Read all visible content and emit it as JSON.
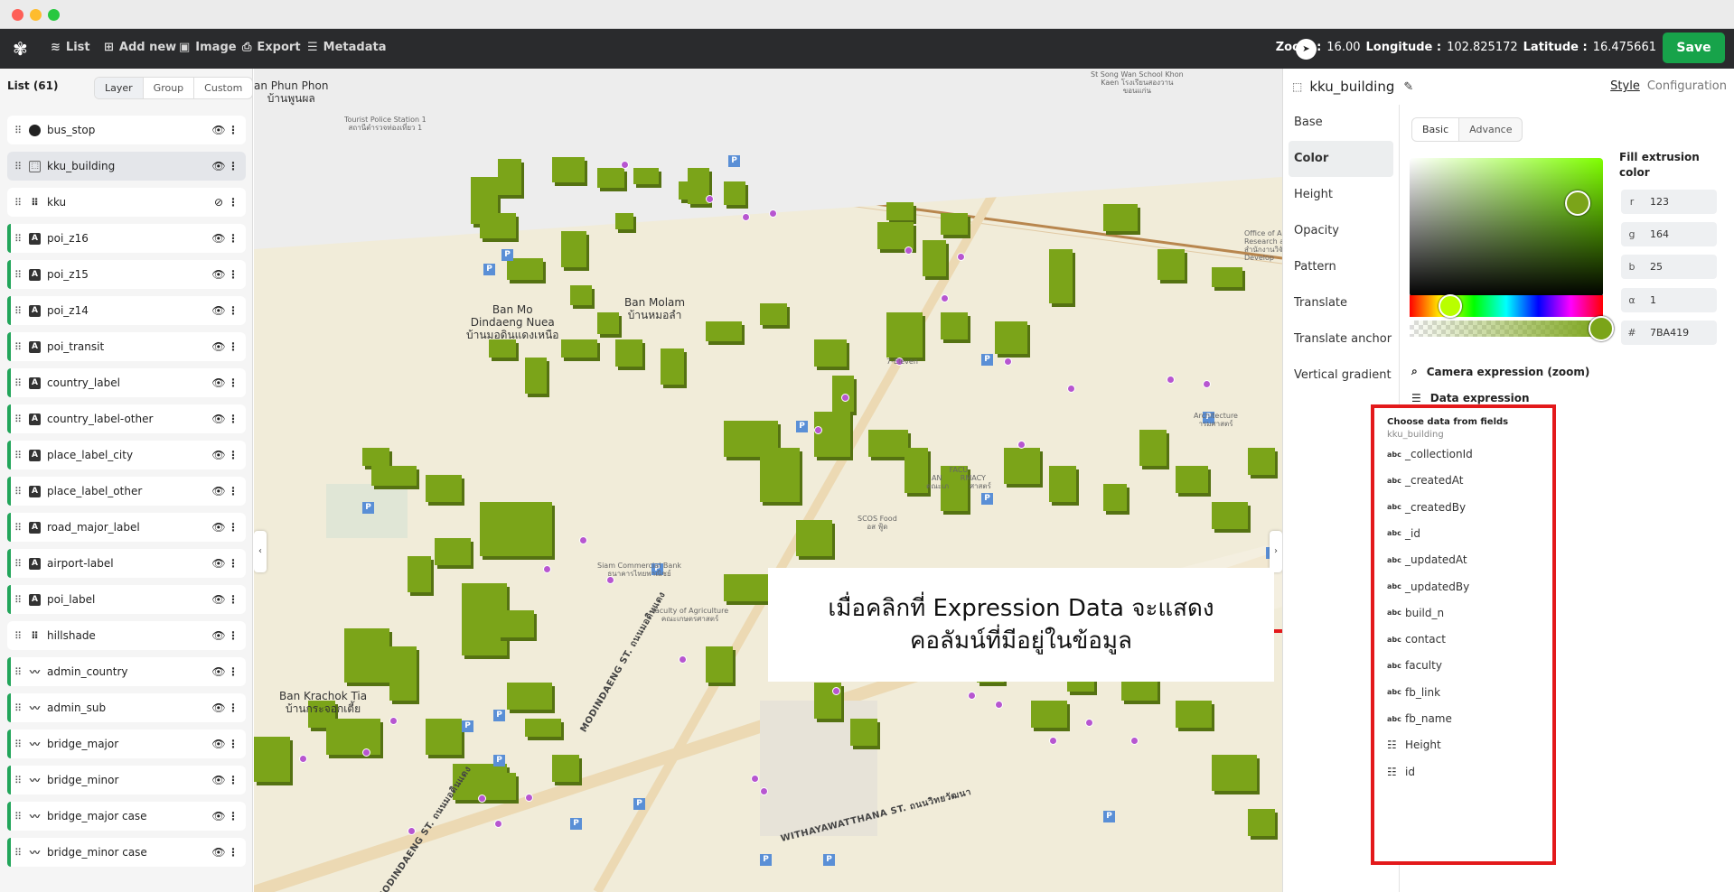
{
  "topbar": {
    "nav": [
      {
        "label": "List",
        "icon": "layers-icon"
      },
      {
        "label": "Add new",
        "icon": "add-icon"
      },
      {
        "label": "Image",
        "icon": "image-icon"
      },
      {
        "label": "Export",
        "icon": "export-icon"
      },
      {
        "label": "Metadata",
        "icon": "metadata-icon"
      }
    ],
    "zoom_label": "Zoom :",
    "zoom_value": "16.00",
    "lon_label": "Longitude :",
    "lon_value": "102.825172",
    "lat_label": "Latitude :",
    "lat_value": "16.475661",
    "save_label": "Save",
    "accent": "#17a34a"
  },
  "left_panel": {
    "title": "List (61)",
    "segments": [
      "Layer",
      "Group",
      "Custom"
    ],
    "active_segment": "Layer",
    "layers": [
      {
        "name": "bus_stop",
        "type": "circle",
        "visible": true
      },
      {
        "name": "kku_building",
        "type": "fill-extrusion",
        "visible": true,
        "selected": true
      },
      {
        "name": "kku",
        "type": "raster",
        "visible": false
      },
      {
        "name": "poi_z16",
        "type": "symbol",
        "visible": true
      },
      {
        "name": "poi_z15",
        "type": "symbol",
        "visible": true
      },
      {
        "name": "poi_z14",
        "type": "symbol",
        "visible": true
      },
      {
        "name": "poi_transit",
        "type": "symbol",
        "visible": true
      },
      {
        "name": "country_label",
        "type": "symbol",
        "visible": true
      },
      {
        "name": "country_label-other",
        "type": "symbol",
        "visible": true
      },
      {
        "name": "place_label_city",
        "type": "symbol",
        "visible": true
      },
      {
        "name": "place_label_other",
        "type": "symbol",
        "visible": true
      },
      {
        "name": "road_major_label",
        "type": "symbol",
        "visible": true
      },
      {
        "name": "airport-label",
        "type": "symbol",
        "visible": true
      },
      {
        "name": "poi_label",
        "type": "symbol",
        "visible": true
      },
      {
        "name": "hillshade",
        "type": "raster",
        "visible": true
      },
      {
        "name": "admin_country",
        "type": "line",
        "visible": true
      },
      {
        "name": "admin_sub",
        "type": "line",
        "visible": true
      },
      {
        "name": "bridge_major",
        "type": "line",
        "visible": true
      },
      {
        "name": "bridge_minor",
        "type": "line",
        "visible": true
      },
      {
        "name": "bridge_major case",
        "type": "line",
        "visible": true
      },
      {
        "name": "bridge_minor case",
        "type": "line",
        "visible": true
      }
    ]
  },
  "map": {
    "labels": {
      "phun_phon": "an Phun Phon\nบ้านพูนผล",
      "ban_mo": "Ban Mo\nDindaeng Nuea\nบ้านมอดินแดงเหนือ",
      "ban_molam": "Ban Molam\nบ้านหมอลำ",
      "krachok": "Ban Krachok Tia\nบ้านกระจอกเตี้ย",
      "seven": "7-Eleven",
      "agri": "Faculty of Agriculture\nคณะเกษตรศาสตร์",
      "architecture": "Architecture\nารมศาสตร์",
      "scos": "SCOS Food\nอส ฟู้ด",
      "siam": "Siam Commercial Bank\nธนาคารไทยพาณิชย์",
      "pharmacy": "FACU\nAN        RMACY\nคณะเภ         ศาสตร์",
      "songwan": "St Song Wan School Khon\nKaen โรงเรียนสองวาน\nขอนแก่น",
      "station": "Tourist Police Station 1\nสถานีตำรวจท่องเที่ยว 1",
      "office": "Office of Agr\nResearch a\nสำนักงานวิจัย\nDevelop",
      "road1": "WITHAYAWATTHANA ST. ถนนวิทยวัฒนา",
      "road2": "MODINDAENG ST. ถนนมอดินแดง"
    },
    "callout": "เมื่อคลิกที่ Expression Data จะแสดง\nคอลัมน์ที่มีอยู่ในข้อมูล",
    "building_color": "#7BA419"
  },
  "right_panel": {
    "layer_name": "kku_building",
    "tabs": [
      "Style",
      "Configuration"
    ],
    "active_tab": "Style",
    "categories": [
      "Base",
      "Color",
      "Height",
      "Opacity",
      "Pattern",
      "Translate",
      "Translate anchor",
      "Vertical gradient"
    ],
    "active_category": "Color",
    "mode_tabs": [
      "Basic",
      "Advance"
    ],
    "active_mode": "Basic",
    "property_label": "Fill extrusion color",
    "color": {
      "r": "123",
      "g": "164",
      "b": "25",
      "a": "1",
      "hex": "7BA419",
      "r_key": "r",
      "g_key": "g",
      "b_key": "b",
      "a_key": "α",
      "hex_key": "#"
    },
    "camera_expression": "Camera expression (zoom)",
    "data_expression": "Data expression",
    "dropdown": {
      "title": "Choose data from fields",
      "source": "kku_building",
      "fields": [
        {
          "name": "_collectionId",
          "type": "abc"
        },
        {
          "name": "_createdAt",
          "type": "abc"
        },
        {
          "name": "_createdBy",
          "type": "abc"
        },
        {
          "name": "_id",
          "type": "abc"
        },
        {
          "name": "_updatedAt",
          "type": "abc"
        },
        {
          "name": "_updatedBy",
          "type": "abc"
        },
        {
          "name": "build_n",
          "type": "abc"
        },
        {
          "name": "contact",
          "type": "abc"
        },
        {
          "name": "faculty",
          "type": "abc"
        },
        {
          "name": "fb_link",
          "type": "abc"
        },
        {
          "name": "fb_name",
          "type": "abc"
        },
        {
          "name": "Height",
          "type": "number"
        },
        {
          "name": "id",
          "type": "number"
        }
      ]
    },
    "highlight_color": "#e3191b"
  }
}
